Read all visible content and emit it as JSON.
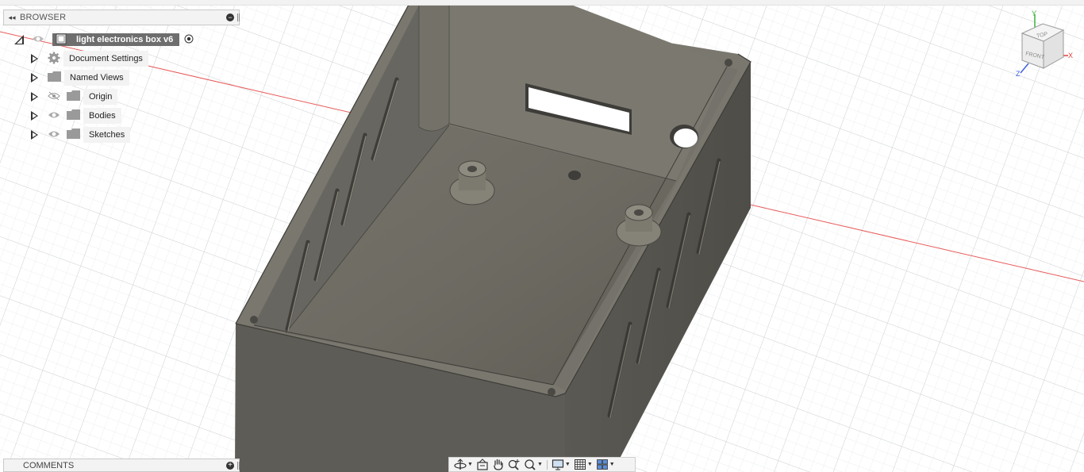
{
  "browser": {
    "header_title": "BROWSER",
    "root": {
      "label": "light electronics box v6"
    },
    "items": [
      {
        "label": "Document Settings",
        "icon": "gear-icon",
        "visibility": "none"
      },
      {
        "label": "Named Views",
        "icon": "folder-icon",
        "visibility": "none"
      },
      {
        "label": "Origin",
        "icon": "folder-icon",
        "visibility": "hidden"
      },
      {
        "label": "Bodies",
        "icon": "folder-icon",
        "visibility": "visible"
      },
      {
        "label": "Sketches",
        "icon": "folder-icon",
        "visibility": "visible"
      }
    ]
  },
  "viewcube": {
    "top": "TOP",
    "front": "FRONT",
    "x": "X",
    "y": "Y",
    "z": "Z"
  },
  "comments": {
    "title": "COMMENTS"
  },
  "toolbar": {
    "buttons": [
      "orbit-icon",
      "look-at-icon",
      "pan-icon",
      "zoom-icon",
      "fit-icon",
      "display-settings-icon",
      "grid-icon",
      "viewports-icon"
    ]
  },
  "colors": {
    "model": "#6a675f",
    "grid": "#d9dde0",
    "x_axis": "#e04040",
    "highlight": "#6e6e6e"
  }
}
